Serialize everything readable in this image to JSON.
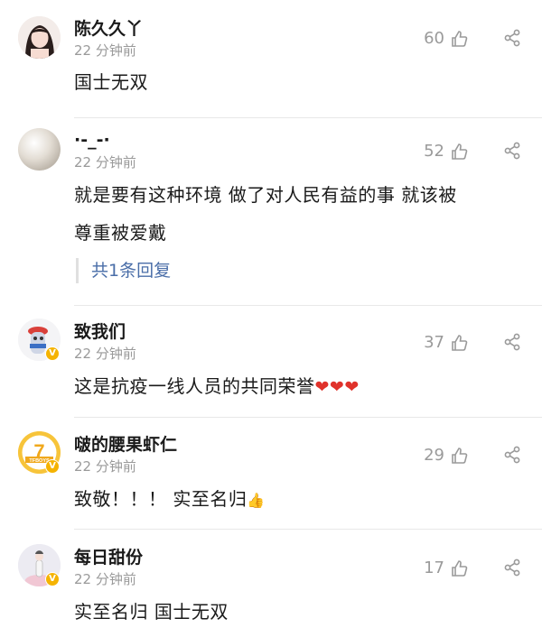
{
  "comments": [
    {
      "name": "陈久久丫",
      "time": "22 分钟前",
      "text": "国士无双",
      "likes": "60"
    },
    {
      "name": "·-_-·",
      "time": "22 分钟前",
      "text_line1": "就是要有这种环境 做了对人民有益的事 就该被",
      "text_line2": "尊重被爱戴",
      "likes": "52",
      "reply_link": "共1条回复"
    },
    {
      "name": "致我们",
      "time": "22 分钟前",
      "text": "这是抗疫一线人员的共同荣誉",
      "hearts": "❤❤❤",
      "likes": "37"
    },
    {
      "name": "啵的腰果虾仁",
      "time": "22 分钟前",
      "text": "致敬！！！ 实至名归",
      "emoji": "👍",
      "likes": "29",
      "avatar_text": "TFBOYS"
    },
    {
      "name": "每日甜份",
      "time": "22 分钟前",
      "text": "实至名归 国士无双",
      "likes": "17"
    }
  ],
  "colors": {
    "name": "#1a1a1a",
    "meta": "#9a9a9a",
    "reply": "#4a6ea8",
    "badge": "#f5b301",
    "heart": "#e0322b"
  }
}
